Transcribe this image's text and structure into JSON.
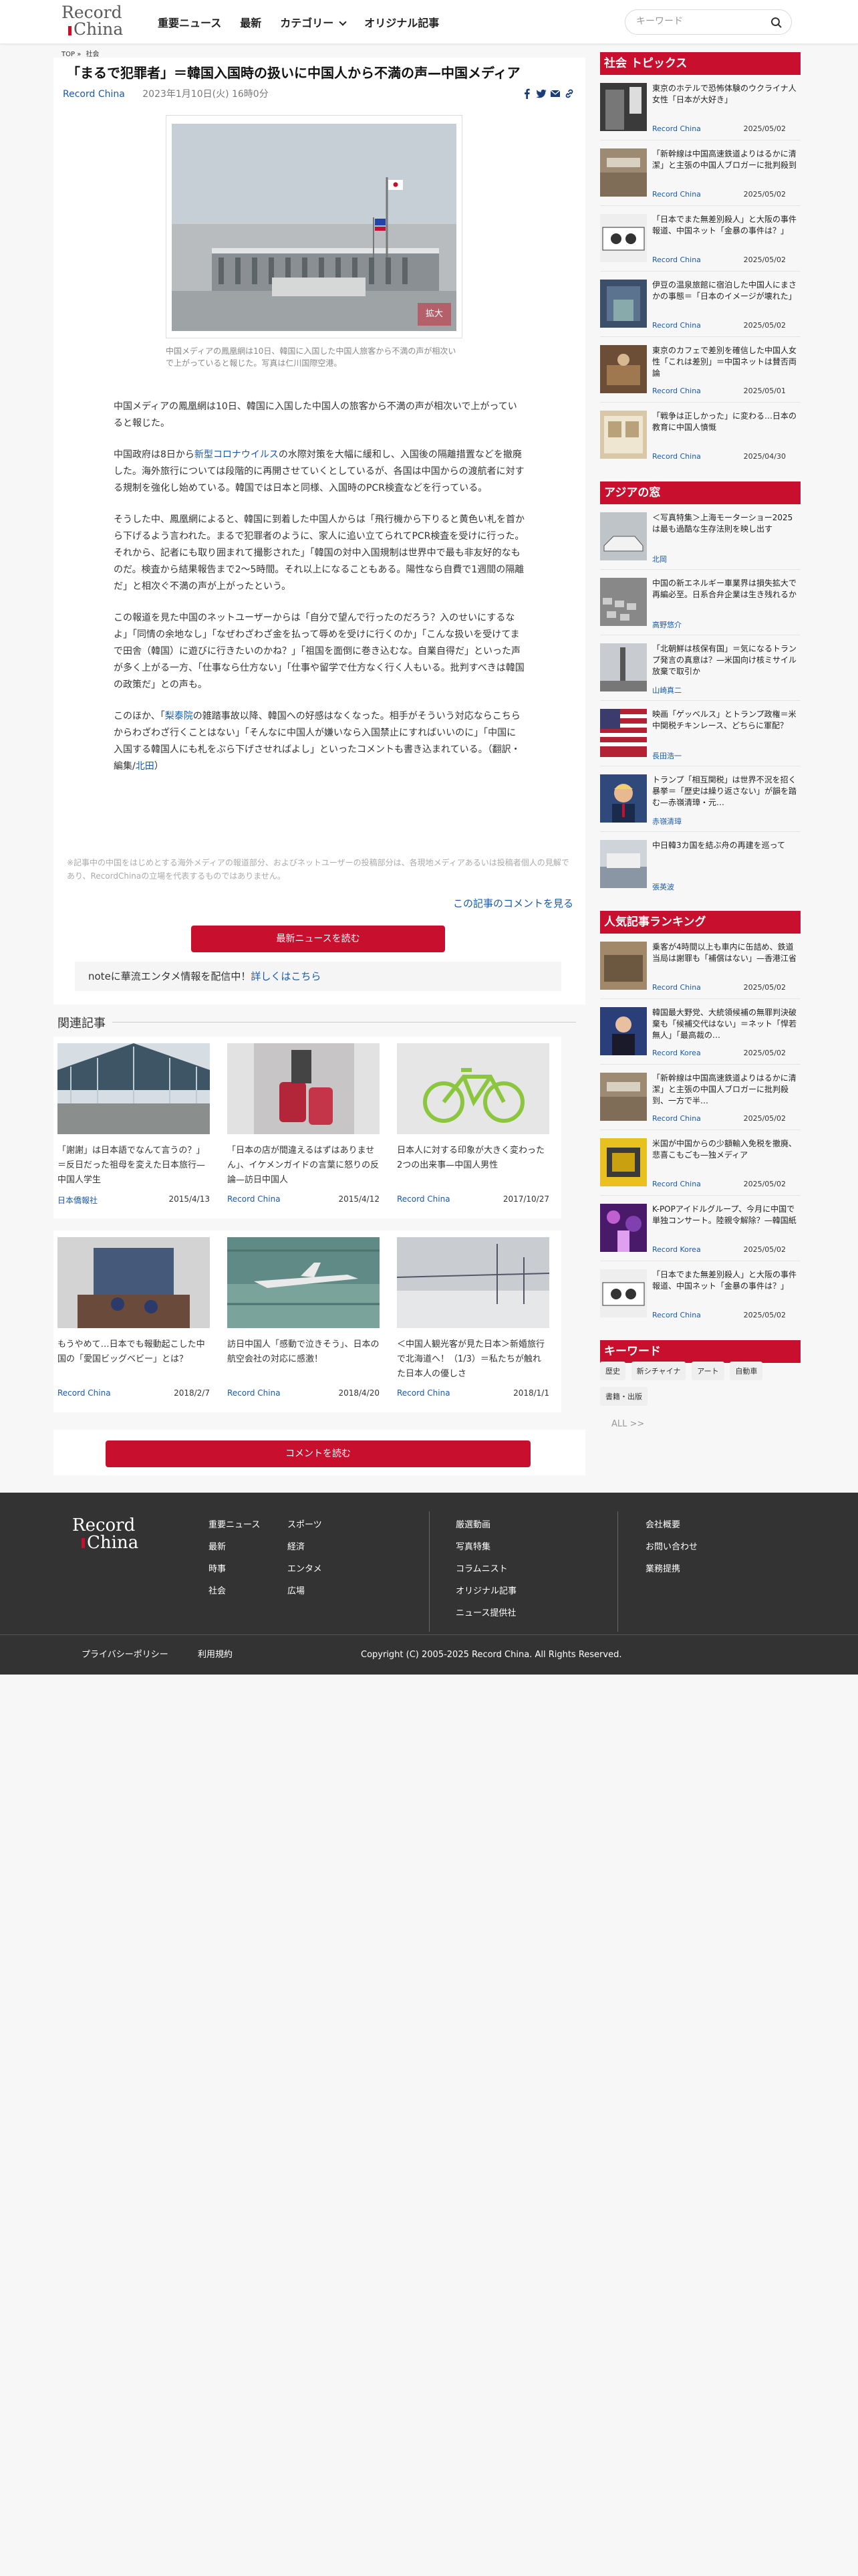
{
  "header": {
    "logo_line1": "Record",
    "logo_line2": "China",
    "nav": [
      "重要ニュース",
      "最新",
      "カテゴリー",
      "オリジナル記事"
    ],
    "search_placeholder": "キーワード"
  },
  "breadcrumb": [
    "TOP",
    "»",
    "社会"
  ],
  "article": {
    "title": "「まるで犯罪者」＝韓国入国時の扱いに中国人から不満の声—中国メディア",
    "source": "Record China",
    "date": "2023年1月10日(火) 16時0分",
    "zoom_label": "拡大",
    "caption": "中国メディアの鳳凰網は10日、韓国に入国した中国人旅客から不満の声が相次いで上がっていると報じた。写真は仁川国際空港。",
    "paragraphs": [
      {
        "text": "中国メディアの鳳凰網は10日、韓国に入国した中国人の旅客から不満の声が相次いで上がっていると報じた。"
      },
      {
        "before": "中国政府は8日から",
        "link": "新型コロナウイルス",
        "after": "の水際対策を大幅に緩和し、入国後の隔離措置などを撤廃した。海外旅行については段階的に再開させていくとしているが、各国は中国からの渡航者に対する規制を強化し始めている。韓国では日本と同様、入国時のPCR検査などを行っている。"
      },
      {
        "text": "そうした中、鳳凰網によると、韓国に到着した中国人からは「飛行機から下りると黄色い札を首から下げるよう言われた。まるで犯罪者のように、家人に追い立てられてPCR検査を受けに行った。それから、記者にも取り囲まれて撮影された」「韓国の対中入国規制は世界中で最も非友好的なものだ。検査から結果報告まで2〜5時間。それ以上になることもある。陽性なら自費で1週間の隔離だ」と相次ぐ不満の声が上がったという。"
      },
      {
        "text": "この報道を見た中国のネットユーザーからは「自分で望んで行ったのだろう？入のせいにするなよ」「同情の余地なし」「なぜわざわざ金を払って辱めを受けに行くのか」「こんな扱いを受けてまで田舎（韓国）に遊びに行きたいのかね？」「祖国を面倒に巻き込むな。自業自得だ」といった声が多く上がる一方、「仕事なら仕方ない」「仕事や留学で仕方なく行く人もいる。批判すべきは韓国の政策だ」との声も。"
      },
      {
        "before": "このほか、「",
        "link": "梨泰院",
        "after": "の雑踏事故以降、韓国への好感はなくなった。相手がそういう対応ならこちらからわざわざ行くことはない」「そんなに中国人が嫌いなら入国禁止にすればいいのに」「中国に入国する韓国人にも札をぶら下げさせればよし」といったコメントも書き込まれている。（翻訳・編集/",
        "link2": "北田",
        "after2": "）"
      }
    ],
    "disclaimer": "※記事中の中国をはじめとする海外メディアの報道部分、およびネットユーザーの投稿部分は、各現地メディアあるいは投稿者個人の見解であり、RecordChinaの立場を代表するものではありません。",
    "comments_link": "この記事のコメントを見る",
    "latest_button": "最新ニュースを読む",
    "note_text": "noteに華流エンタメ情報を配信中！",
    "note_link": "詳しくはこちら",
    "comment_button": "コメントを読む"
  },
  "related": {
    "heading": "関連記事",
    "items": [
      {
        "title": "「謝謝」は日本語でなんて言うの？」＝反日だった祖母を変えた日本旅行—中国人学生",
        "source": "日本僑報社",
        "date": "2015/4/13"
      },
      {
        "title": "「日本の店が間違えるはずはありません」、イケメンガイドの言葉に怒りの反論—訪日中国人",
        "source": "Record China",
        "date": "2015/4/12"
      },
      {
        "title": "日本人に対する印象が大きく変わった2つの出来事—中国人男性",
        "source": "Record China",
        "date": "2017/10/27"
      },
      {
        "title": "もうやめて…日本でも報動起こした中国の「愛国ビッグベビー」とは？",
        "source": "Record China",
        "date": "2018/2/7"
      },
      {
        "title": "訪日中国人「感動で泣きそう」、日本の航空会社の対応に感激！",
        "source": "Record China",
        "date": "2018/4/20"
      },
      {
        "title": "＜中国人観光客が見た日本＞新婚旅行で北海道へ！（1/3）＝私たちが触れた日本人の優しさ",
        "source": "Record China",
        "date": "2018/1/1"
      }
    ]
  },
  "sidebar": {
    "topics": {
      "heading": "社会 トピックス",
      "items": [
        {
          "title": "東京のホテルで恐怖体験のウクライナ人女性「日本が大好き」",
          "source": "Record China",
          "date": "2025/05/02"
        },
        {
          "title": "「新幹線は中国高速鉄道よりはるかに清潔」と主張の中国人ブロガーに批判殺到",
          "source": "Record China",
          "date": "2025/05/02"
        },
        {
          "title": "「日本でまた無差別殺人」と大阪の事件報道、中国ネット「金暴の事件は？」",
          "source": "Record China",
          "date": "2025/05/02"
        },
        {
          "title": "伊豆の温泉旅館に宿泊した中国人にまさかの事態＝「日本のイメージが壊れた」",
          "source": "Record China",
          "date": "2025/05/02"
        },
        {
          "title": "東京のカフェで差別を確信した中国人女性「これは差別」＝中国ネットは賛否両論",
          "source": "Record China",
          "date": "2025/05/01"
        },
        {
          "title": "「戦争は正しかった」に変わる…日本の教育に中国人憤慨",
          "source": "Record China",
          "date": "2025/04/30"
        }
      ]
    },
    "asia": {
      "heading": "アジアの窓",
      "items": [
        {
          "title": "＜写真特集＞上海モーターショー2025は最も過酷な生存法則を映し出す",
          "source": "北岡"
        },
        {
          "title": "中国の新エネルギー車業界は損失拡大で再編必至。日系合弁企業は生き残れるか",
          "source": "高野悠介"
        },
        {
          "title": "「北朝鮮は核保有国」＝気になるトランプ発言の真意は？—米国向け核ミサイル放棄で取引か",
          "source": "山崎真二"
        },
        {
          "title": "映画「ゲッベルス」とトランプ政権＝米中関税チキンレース、どちらに軍配？",
          "source": "長田浩一"
        },
        {
          "title": "トランプ「相互関税」は世界不況を招く暴挙＝「歴史は繰り返さない」が韻を踏む—赤嶺清璋・元…",
          "source": "赤嶺清璋"
        },
        {
          "title": "中日韓3カ国を結ぶ舟の再建を巡って",
          "source": "張英波"
        }
      ]
    },
    "ranking": {
      "heading": "人気記事ランキング",
      "items": [
        {
          "title": "乗客が4時間以上も車内に缶詰め、鉄道当局は謝罪も「補償はない」—香港江省",
          "source": "Record China",
          "date": "2025/05/02"
        },
        {
          "title": "韓国最大野党、大統領候補の無罪判決破棄も「候補交代はない」＝ネット「悍若無人」「最高裁の…",
          "source": "Record Korea",
          "date": "2025/05/02"
        },
        {
          "title": "「新幹線は中国高速鉄道よりはるかに清潔」と主張の中国人ブロガーに批判殺到、一方で半…",
          "source": "Record China",
          "date": "2025/05/02"
        },
        {
          "title": "米国が中国からの少額輸入免税を撤廃、悲喜こもごも—独メディア",
          "source": "Record China",
          "date": "2025/05/02"
        },
        {
          "title": "K-POPアイドルグループ、今月に中国で単独コンサート。陸親令解除？—韓国紙",
          "source": "Record Korea",
          "date": "2025/05/02"
        },
        {
          "title": "「日本でまた無差別殺人」と大阪の事件報道、中国ネット「金暴の事件は？」",
          "source": "Record China",
          "date": "2025/05/02"
        }
      ]
    },
    "keywords": {
      "heading": "キーワード",
      "items": [
        "歴史",
        "新シチャイナ",
        "アート",
        "自動車",
        "書籍・出版"
      ],
      "all": "ALL",
      "all_arrow": ">>"
    }
  },
  "footer": {
    "logo_line1": "Record",
    "logo_line2": "China",
    "col1": [
      "重要ニュース",
      "最新",
      "時事",
      "社会"
    ],
    "col2": [
      "スポーツ",
      "経済",
      "エンタメ",
      "広場"
    ],
    "col3": [
      "厳選動画",
      "写真特集",
      "コラムニスト",
      "オリジナル記事",
      "ニュース提供社"
    ],
    "col4": [
      "会社概要",
      "お問い合わせ",
      "業務提携"
    ],
    "privacy": "プライバシーポリシー",
    "terms": "利用規約",
    "copyright": "Copyright (C) 2005-2025 Record China. All Rights Reserved."
  }
}
